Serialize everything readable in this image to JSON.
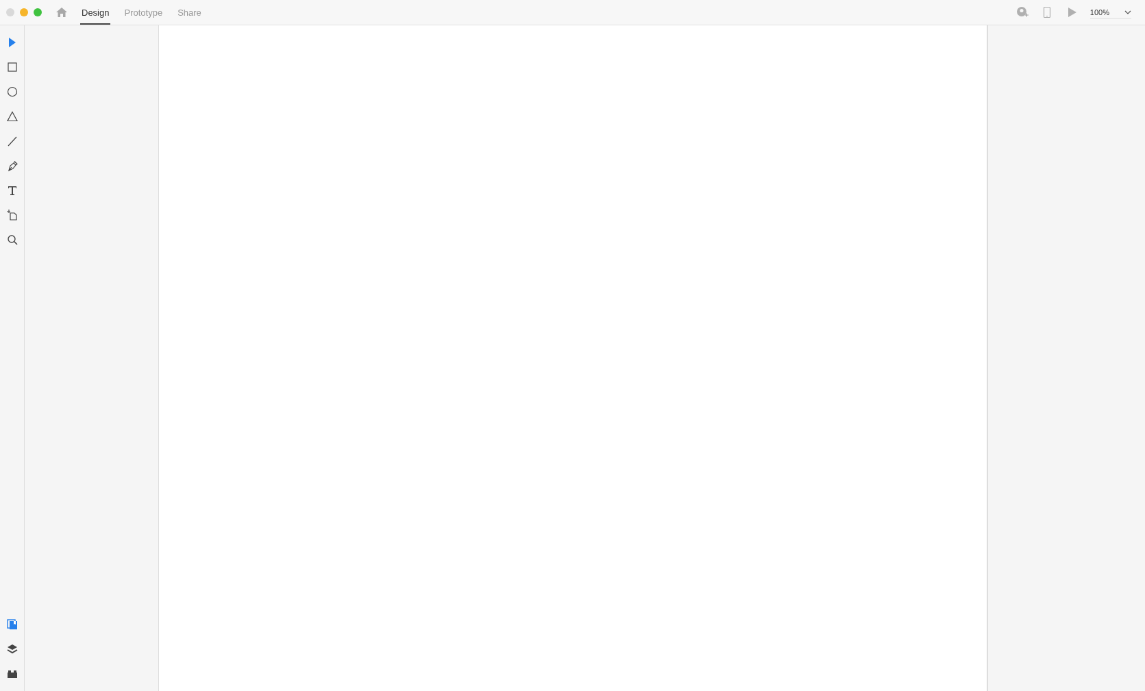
{
  "tabs": [
    {
      "label": "Design",
      "selected": true
    },
    {
      "label": "Prototype",
      "selected": false
    },
    {
      "label": "Share",
      "selected": false
    }
  ],
  "zoom": {
    "value": "100%"
  },
  "tools": [
    {
      "kind": "select",
      "selected": true
    },
    {
      "kind": "rectangle",
      "selected": false
    },
    {
      "kind": "ellipse",
      "selected": false
    },
    {
      "kind": "polygon",
      "selected": false
    },
    {
      "kind": "line",
      "selected": false
    },
    {
      "kind": "pen",
      "selected": false
    },
    {
      "kind": "text",
      "selected": false
    },
    {
      "kind": "artboard",
      "selected": false
    },
    {
      "kind": "zoom",
      "selected": false
    }
  ],
  "panels": [
    {
      "kind": "assets",
      "selected": true
    },
    {
      "kind": "layers",
      "selected": false
    },
    {
      "kind": "plugins",
      "selected": false
    }
  ]
}
